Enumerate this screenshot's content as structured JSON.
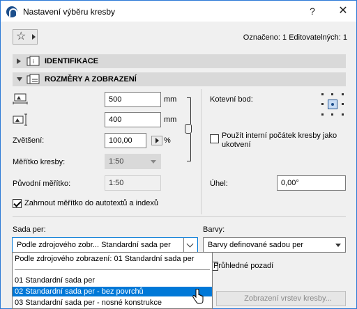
{
  "window": {
    "title": "Nastavení výběru kresby",
    "help_glyph": "?",
    "close_glyph": "✕"
  },
  "toolbar": {
    "favorites_icon": "star-icon",
    "selection_info": "Označeno: 1 Editovatelných: 1"
  },
  "sections": [
    {
      "label": "IDENTIFIKACE",
      "expanded": false,
      "icon": "drawing-id-icon"
    },
    {
      "label": "ROZMĚRY A ZOBRAZENÍ",
      "expanded": true,
      "icon": "drawing-size-icon"
    }
  ],
  "size": {
    "width_value": "500",
    "width_unit": "mm",
    "height_value": "400",
    "height_unit": "mm",
    "zoom_label": "Zvětšení:",
    "zoom_value": "100,00",
    "zoom_unit": "%",
    "drawing_scale_label": "Měřítko kresby:",
    "drawing_scale_value": "1:50",
    "original_scale_label": "Původní měřítko:",
    "original_scale_value": "1:50",
    "include_scale_label": "Zahrnout měřítko do autotextů a indexů",
    "include_scale_checked": true
  },
  "anchor": {
    "label": "Kotevní bod:",
    "use_internal_origin_label": "Použít interní počátek kresby jako ukotvení",
    "use_internal_origin_checked": false,
    "angle_label": "Úhel:",
    "angle_value": "0,00°"
  },
  "pen_set": {
    "label": "Sada per:",
    "value": "Podle zdrojového zobr... Standardní sada per",
    "options": [
      "Podle zdrojového zobrazení: 01 Standardní sada per",
      "01 Standardní sada per",
      "02 Standardní sada per - bez povrchů",
      "03 Standardní sada per - nosné konstrukce"
    ],
    "highlighted_index": 2
  },
  "colors": {
    "label": "Barvy:",
    "value": "Barvy definované sadou per",
    "transparent_bg_label": "Průhledné pozadí"
  },
  "layers_button": {
    "label": "Zobrazení vrstev kresby..."
  },
  "accent_color": "#0078d7"
}
